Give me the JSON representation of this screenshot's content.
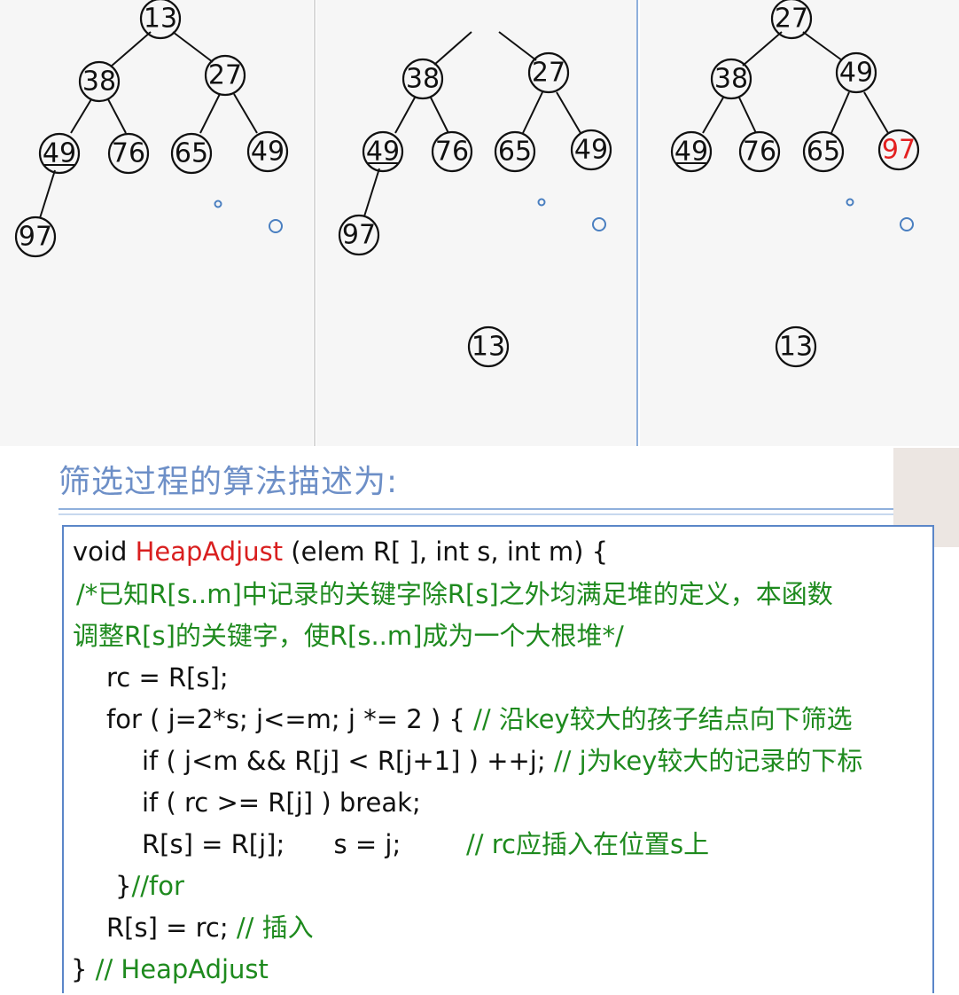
{
  "panels": [
    {
      "nodes": [
        {
          "id": "n1",
          "label": "13"
        },
        {
          "id": "n2",
          "label": "38"
        },
        {
          "id": "n3",
          "label": "27"
        },
        {
          "id": "n4",
          "label": "49",
          "underline": true
        },
        {
          "id": "n5",
          "label": "76"
        },
        {
          "id": "n6",
          "label": "65"
        },
        {
          "id": "n7",
          "label": "49"
        },
        {
          "id": "n8",
          "label": "97"
        }
      ]
    },
    {
      "nodes": [
        {
          "id": "n2",
          "label": "38"
        },
        {
          "id": "n3",
          "label": "27"
        },
        {
          "id": "n4",
          "label": "49",
          "underline": true
        },
        {
          "id": "n5",
          "label": "76"
        },
        {
          "id": "n6",
          "label": "65"
        },
        {
          "id": "n7",
          "label": "49"
        },
        {
          "id": "n8",
          "label": "97"
        },
        {
          "id": "n9",
          "label": "13"
        }
      ]
    },
    {
      "nodes": [
        {
          "id": "n1",
          "label": "27"
        },
        {
          "id": "n2",
          "label": "38"
        },
        {
          "id": "n3",
          "label": "49"
        },
        {
          "id": "n4",
          "label": "49",
          "underline": true
        },
        {
          "id": "n5",
          "label": "76"
        },
        {
          "id": "n6",
          "label": "65"
        },
        {
          "id": "n7",
          "label": "97",
          "color": "#e32020"
        },
        {
          "id": "n9",
          "label": "13"
        }
      ]
    }
  ],
  "heading": "筛选过程的算法描述为:",
  "code": {
    "l1_a": "void ",
    "l1_fn": "HeapAdjust",
    "l1_b": " (elem R[ ], int s, int m) {",
    "l2": "/*已知R[s..m]中记录的关键字除R[s]之外均满足堆的定义，本函数",
    "l3": "调整R[s]的关键字，使R[s..m]成为一个大根堆*/",
    "l4": "rc = R[s];",
    "l5_code": "for ( j=2*s; j<=m; j *= 2 ) { ",
    "l5_cm": "// 沿key较大的孩子结点向下筛选",
    "l6_code": "if ( j<m && R[j] < R[j+1] ) ++j; ",
    "l6_cm": "// j为key较大的记录的下标",
    "l7": "if ( rc >= R[j] ) break;",
    "l8_code": "R[s] = R[j];      s = j;        ",
    "l8_cm": "// rc应插入在位置s上",
    "l9_code": "}",
    "l9_cm": "//for",
    "l10_code": "R[s] = rc; ",
    "l10_cm": "// 插入",
    "l11_code": "} ",
    "l11_cm": "// HeapAdjust"
  }
}
